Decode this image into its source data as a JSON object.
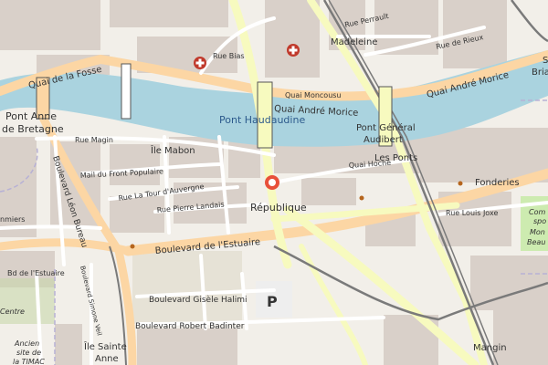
{
  "map": {
    "colors": {
      "land": "#f2efe9",
      "water": "#aad3df",
      "building": "#d9d0c9",
      "primary_road": "#fcd6a4",
      "secondary_road": "#f7fabf",
      "minor_road": "#ffffff",
      "rail": "#7a7a7a",
      "marker": "#e8503a",
      "hospital": "#c0392b",
      "park": "#cdebb0",
      "grass": "#c8d7ab"
    },
    "marker": {
      "label": "République",
      "icon": "location-pin-icon"
    },
    "labels": {
      "pont_haudaudine": "Pont Haudaudine",
      "pont_general_1": "Pont Général",
      "pont_general_2": "Audibert",
      "pont_anne_1": "Pont Anne",
      "pont_anne_2": "de Bretagne",
      "quai_de_la_fosse": "Quai de la Fosse",
      "quai_andre_morice_1": "Quai André Morice",
      "quai_andre_morice_2": "Quai André Morice",
      "quai_moncousu": "Quai Moncousu",
      "madeleine": "Madeleine",
      "rue_perrault": "Rue Perrault",
      "rue_de_rieux": "Rue de Rieux",
      "rue_bias": "Rue Bias",
      "ile_mabon": "Île Mabon",
      "rue_magin": "Rue Magin",
      "mail_du_front_populaire": "Mail du Front Populaire",
      "rue_la_tour_dauvergne": "Rue La Tour d'Auvergne",
      "rue_pierre_landais": "Rue Pierre Landais",
      "quai_hoche": "Quai Hoche",
      "les_ponts": "Les Ponts",
      "fonderies": "Fonderies",
      "rue_louis_joxe": "Rue Louis Joxe",
      "republique": "République",
      "boulevard_de_lestuaire": "Boulevard de l'Estuaire",
      "boulevard_leon_bureau": "Boulevard Léon Bureau",
      "bd_de_lestuaire_small": "Bd de l'Estuaire",
      "boulevard_gisele_halimi": "Boulevard Gisèle Halimi",
      "boulevard_robert_badinter": "Boulevard Robert Badinter",
      "boulevard_simone_veil": "Boulevard Simone Veil",
      "ile_sainte_anne_1": "Île Sainte",
      "ile_sainte_anne_2": "Anne",
      "ancien_site_1": "Ancien",
      "ancien_site_2": "site de",
      "ancien_site_3": "la TIMAC",
      "mangin": "Mangin",
      "centre": "Centre",
      "saint_nazaire_frag": "Bria",
      "saint_nazaire_frag2": "S",
      "bea_frag": "Beau",
      "mon_frag": "Mon",
      "spo_frag": "spo",
      "com_frag": "Com",
      "smiers_frag": "nmiers",
      "parking": "P"
    }
  }
}
